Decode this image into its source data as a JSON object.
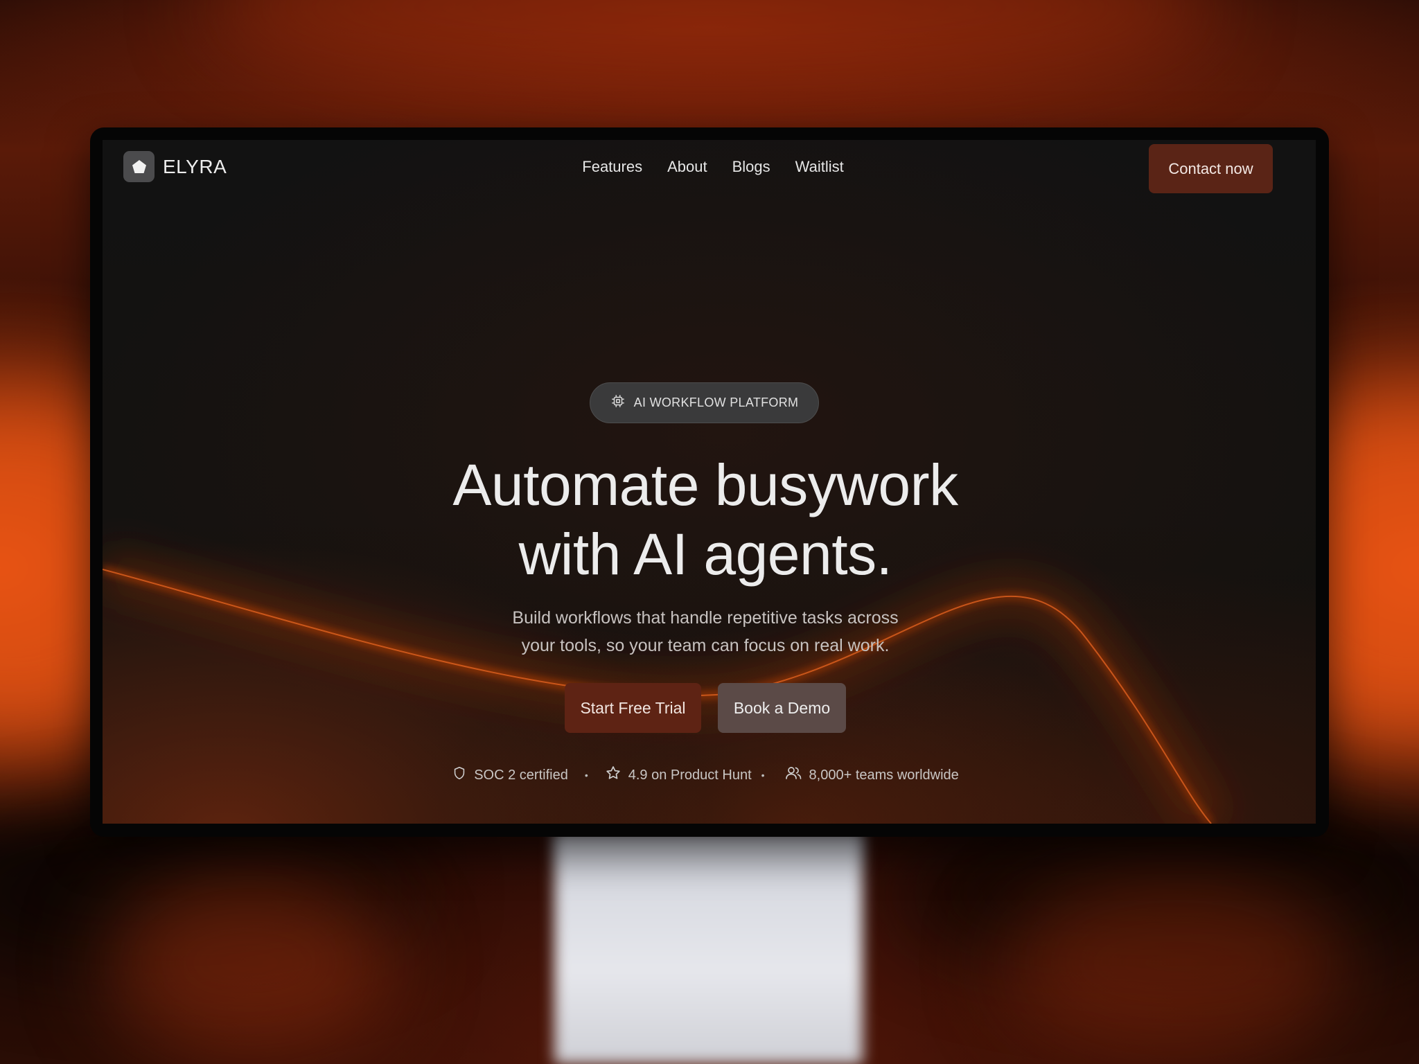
{
  "brand": {
    "name": "ELYRA",
    "logo_icon": "pentagon-icon"
  },
  "nav": {
    "links": [
      "Features",
      "About",
      "Blogs",
      "Waitlist"
    ],
    "contact_label": "Contact now"
  },
  "hero": {
    "badge_icon": "chip-icon",
    "badge_text": "AI WORKFLOW PLATFORM",
    "title_line1": "Automate busywork",
    "title_line2": "with AI agents.",
    "subtitle_line1": "Build workflows that handle repetitive tasks across",
    "subtitle_line2": "your tools, so your team can focus on real work.",
    "primary_cta": "Start Free Trial",
    "secondary_cta": "Book a Demo"
  },
  "trust": {
    "items": [
      {
        "icon": "shield-icon",
        "text": "SOC 2 certified"
      },
      {
        "icon": "star-icon",
        "text": "4.9 on Product Hunt"
      },
      {
        "icon": "users-icon",
        "text": "8,000+ teams worldwide"
      }
    ],
    "separator": "•"
  },
  "colors": {
    "accent": "#5e2314",
    "background_glow": "#e24e12",
    "screen_bg": "#121212"
  }
}
